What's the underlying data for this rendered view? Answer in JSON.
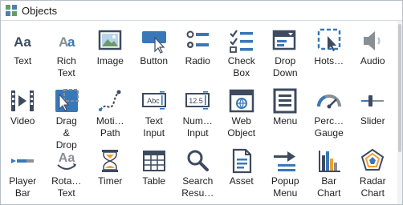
{
  "panel": {
    "title": "Objects",
    "title_icon": "objects-icon"
  },
  "colors": {
    "icon_primary": "#3d4a5f",
    "icon_accent": "#3878b8",
    "icon_gray": "#8a8f96",
    "chart_orange": "#f0a030"
  },
  "items": [
    {
      "label": "Text",
      "icon": "text-icon"
    },
    {
      "label": "Rich\nText",
      "icon": "rich-text-icon"
    },
    {
      "label": "Image",
      "icon": "image-icon"
    },
    {
      "label": "Button",
      "icon": "button-icon"
    },
    {
      "label": "Radio",
      "icon": "radio-icon"
    },
    {
      "label": "Check\nBox",
      "icon": "checkbox-icon"
    },
    {
      "label": "Drop\nDown",
      "icon": "dropdown-icon"
    },
    {
      "label": "Hots…",
      "icon": "hotspot-icon"
    },
    {
      "label": "Audio",
      "icon": "audio-icon"
    },
    {
      "label": "Video",
      "icon": "video-icon"
    },
    {
      "label": "Drag\n&\nDrop",
      "icon": "drag-drop-icon"
    },
    {
      "label": "Moti…\nPath",
      "icon": "motion-path-icon"
    },
    {
      "label": "Text\nInput",
      "icon": "text-input-icon"
    },
    {
      "label": "Num…\nInput",
      "icon": "numeric-input-icon"
    },
    {
      "label": "Web\nObject",
      "icon": "web-object-icon"
    },
    {
      "label": "Menu",
      "icon": "menu-icon"
    },
    {
      "label": "Perc…\nGauge",
      "icon": "percentage-gauge-icon"
    },
    {
      "label": "Slider",
      "icon": "slider-icon"
    },
    {
      "label": "Player\nBar",
      "icon": "player-bar-icon"
    },
    {
      "label": "Rota…\nText",
      "icon": "rotating-text-icon"
    },
    {
      "label": "Timer",
      "icon": "timer-icon"
    },
    {
      "label": "Table",
      "icon": "table-icon"
    },
    {
      "label": "Search\nResu…",
      "icon": "search-results-icon"
    },
    {
      "label": "Asset",
      "icon": "asset-icon"
    },
    {
      "label": "Popup\nMenu",
      "icon": "popup-menu-icon"
    },
    {
      "label": "Bar\nChart",
      "icon": "bar-chart-icon"
    },
    {
      "label": "Radar\nChart",
      "icon": "radar-chart-icon"
    }
  ]
}
